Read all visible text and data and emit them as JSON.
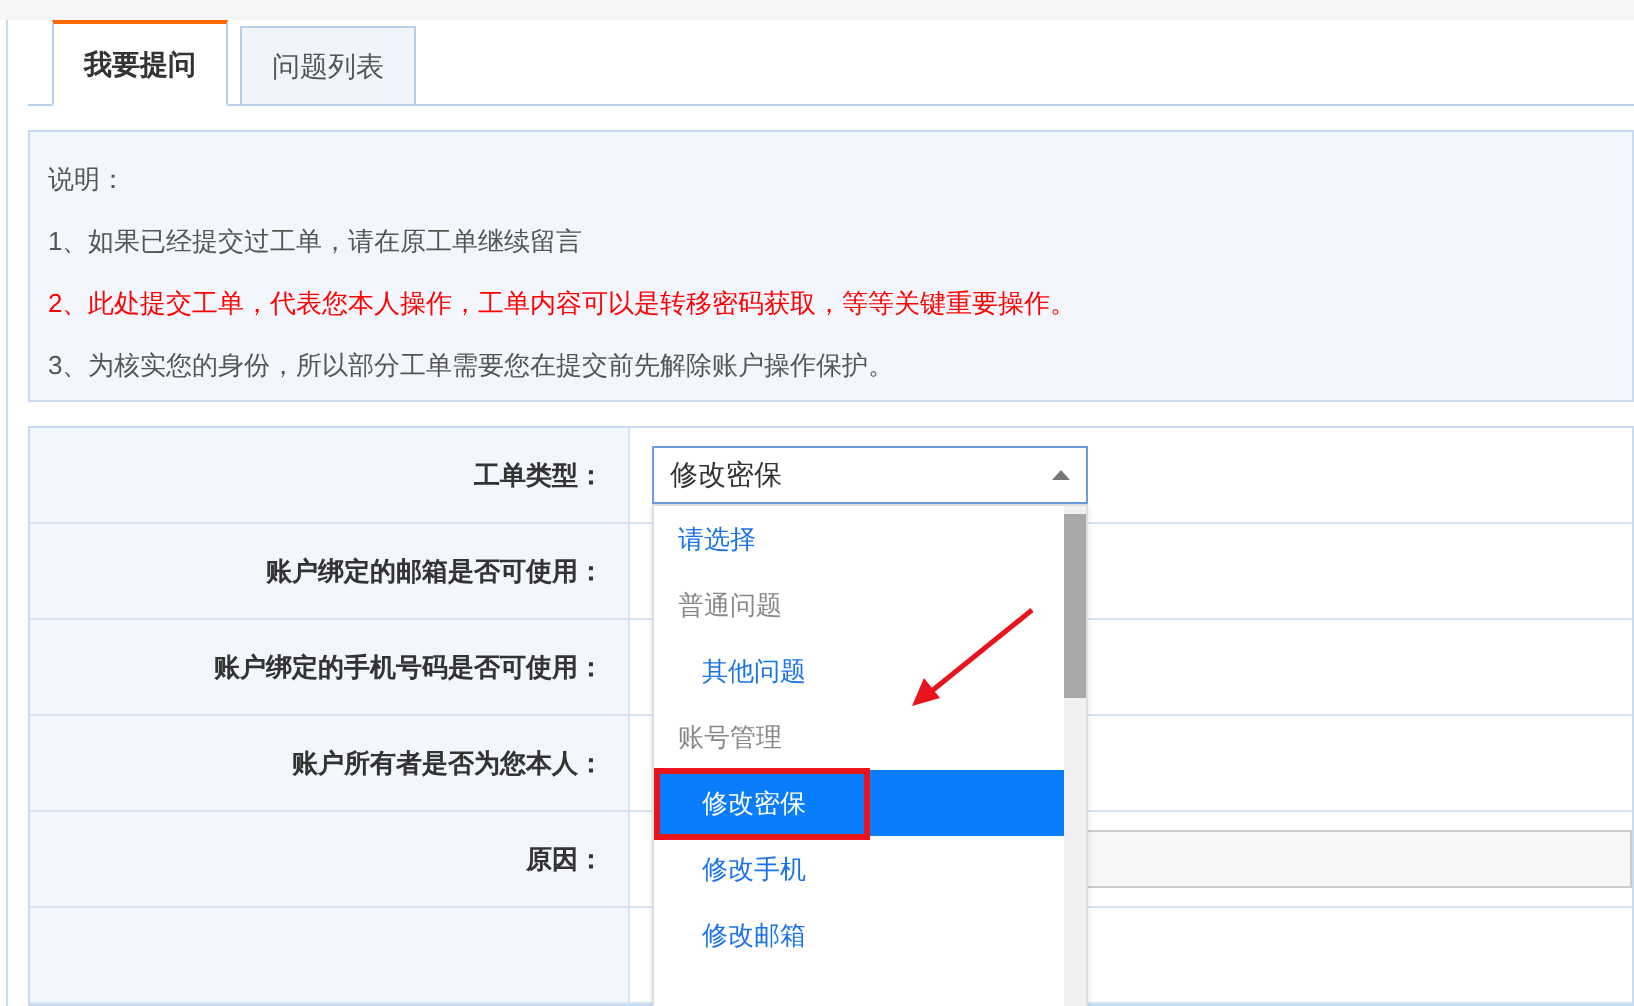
{
  "tabs": [
    {
      "label": "我要提问",
      "selected": true
    },
    {
      "label": "问题列表",
      "selected": false
    }
  ],
  "notice": {
    "title": "说明：",
    "items": [
      {
        "text": "1、如果已经提交过工单，请在原工单继续留言",
        "warning": false
      },
      {
        "text": "2、此处提交工单，代表您本人操作，工单内容可以是转移密码获取，等等关键重要操作。",
        "warning": true
      },
      {
        "text": "3、为核实您的身份，所以部分工单需要您在提交前先解除账户操作保护。",
        "warning": false
      }
    ]
  },
  "form": {
    "rows": [
      {
        "label": "工单类型：",
        "kind": "select",
        "value": "修改密保"
      },
      {
        "label": "账户绑定的邮箱是否可使用：",
        "kind": "blank"
      },
      {
        "label": "账户绑定的手机号码是否可使用：",
        "kind": "blank"
      },
      {
        "label": "账户所有者是否为您本人：",
        "kind": "blank"
      },
      {
        "label": "原因：",
        "kind": "input"
      },
      {
        "label": "",
        "kind": "blank"
      }
    ]
  },
  "dropdown": {
    "options": [
      {
        "label": "请选择",
        "kind": "option",
        "selected": false
      },
      {
        "label": "普通问题",
        "kind": "group",
        "selected": false
      },
      {
        "label": "其他问题",
        "kind": "suboption",
        "selected": false
      },
      {
        "label": "账号管理",
        "kind": "group",
        "selected": false
      },
      {
        "label": "修改密保",
        "kind": "suboption",
        "selected": true
      },
      {
        "label": "修改手机",
        "kind": "suboption",
        "selected": false
      },
      {
        "label": "修改邮箱",
        "kind": "suboption",
        "selected": false
      }
    ]
  }
}
